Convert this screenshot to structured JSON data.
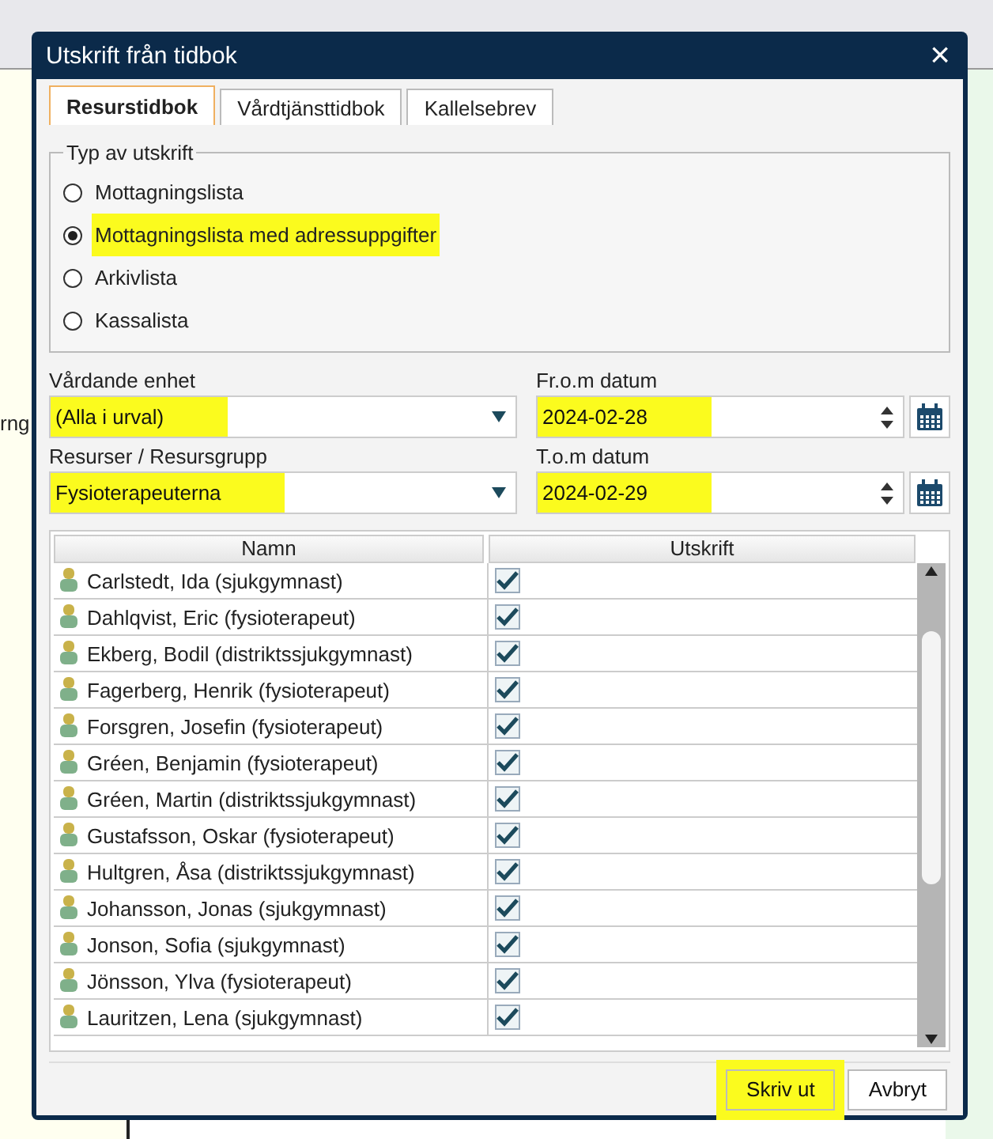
{
  "background": {
    "fragments": [
      "rng"
    ]
  },
  "dialog": {
    "title": "Utskrift från tidbok",
    "close": "×"
  },
  "tabs": [
    {
      "label": "Resurstidbok",
      "selected": true
    },
    {
      "label": "Vårdtjänsttidbok",
      "selected": false
    },
    {
      "label": "Kallelsebrev",
      "selected": false
    }
  ],
  "print_type": {
    "legend": "Typ av utskrift",
    "options": [
      {
        "label": "Mottagningslista",
        "selected": false,
        "highlighted": false
      },
      {
        "label": "Mottagningslista med adressuppgifter",
        "selected": true,
        "highlighted": true
      },
      {
        "label": "Arkivlista",
        "selected": false,
        "highlighted": false
      },
      {
        "label": "Kassalista",
        "selected": false,
        "highlighted": false
      }
    ]
  },
  "fields": [
    {
      "label": "Vårdande enhet",
      "value": "(Alla i urval)",
      "kind": "combo",
      "highlighted": true
    },
    {
      "label": "Fr.o.m datum",
      "value": "2024-02-28",
      "kind": "date",
      "highlighted": true
    },
    {
      "label": "Resurser / Resursgrupp",
      "value": "Fysioterapeuterna",
      "kind": "combo",
      "highlighted": true
    },
    {
      "label": "T.o.m datum",
      "value": "2024-02-29",
      "kind": "date",
      "highlighted": true
    }
  ],
  "table": {
    "columns": [
      "Namn",
      "Utskrift"
    ],
    "rows": [
      {
        "name": "Carlstedt, Ida (sjukgymnast)",
        "checked": true
      },
      {
        "name": "Dahlqvist, Eric (fysioterapeut)",
        "checked": true
      },
      {
        "name": "Ekberg, Bodil (distriktssjukgymnast)",
        "checked": true
      },
      {
        "name": "Fagerberg, Henrik (fysioterapeut)",
        "checked": true
      },
      {
        "name": "Forsgren, Josefin (fysioterapeut)",
        "checked": true
      },
      {
        "name": "Gréen, Benjamin (fysioterapeut)",
        "checked": true
      },
      {
        "name": "Gréen, Martin (distriktssjukgymnast)",
        "checked": true
      },
      {
        "name": "Gustafsson, Oskar (fysioterapeut)",
        "checked": true
      },
      {
        "name": "Hultgren, Åsa (distriktssjukgymnast)",
        "checked": true
      },
      {
        "name": "Johansson, Jonas (sjukgymnast)",
        "checked": true
      },
      {
        "name": "Jonson, Sofia (sjukgymnast)",
        "checked": true
      },
      {
        "name": "Jönsson, Ylva (fysioterapeut)",
        "checked": true
      },
      {
        "name": "Lauritzen, Lena (sjukgymnast)",
        "checked": true
      }
    ]
  },
  "buttons": [
    {
      "label": "Skriv ut",
      "highlighted": true
    },
    {
      "label": "Avbryt",
      "highlighted": false
    }
  ]
}
